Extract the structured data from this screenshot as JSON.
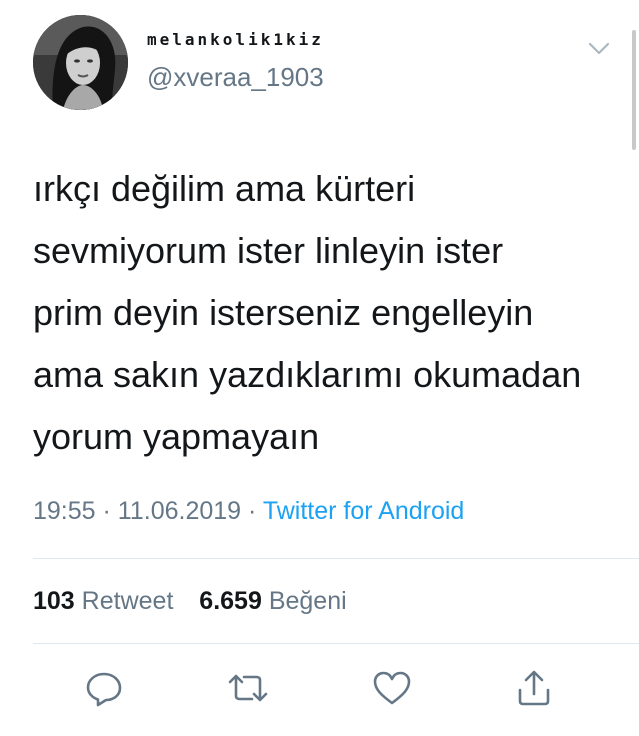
{
  "user": {
    "display_name": "melankolik1kiz",
    "handle": "@xveraa_1903",
    "avatar": "profile-photo"
  },
  "tweet": {
    "lines": [
      "ırkçı değilim ama kürteri",
      "sevmiyorum ister linleyin ister",
      "prim deyin isterseniz engelleyin",
      "ama sakın yazdıklarımı okumadan",
      "yorum yapmayaın"
    ],
    "time": "19:55",
    "date": "11.06.2019",
    "separator": "·",
    "source": "Twitter for Android"
  },
  "stats": {
    "retweets": "103",
    "retweets_label": "Retweet",
    "likes": "6.659",
    "likes_label": "Beğeni"
  },
  "icons": {
    "menu": "chevron-down-icon",
    "reply": "reply-icon",
    "retweet": "retweet-icon",
    "like": "heart-icon",
    "share": "share-icon"
  },
  "colors": {
    "text": "#14171a",
    "secondary": "#657786",
    "link": "#1da1f2",
    "divider": "#e1e8ed"
  }
}
